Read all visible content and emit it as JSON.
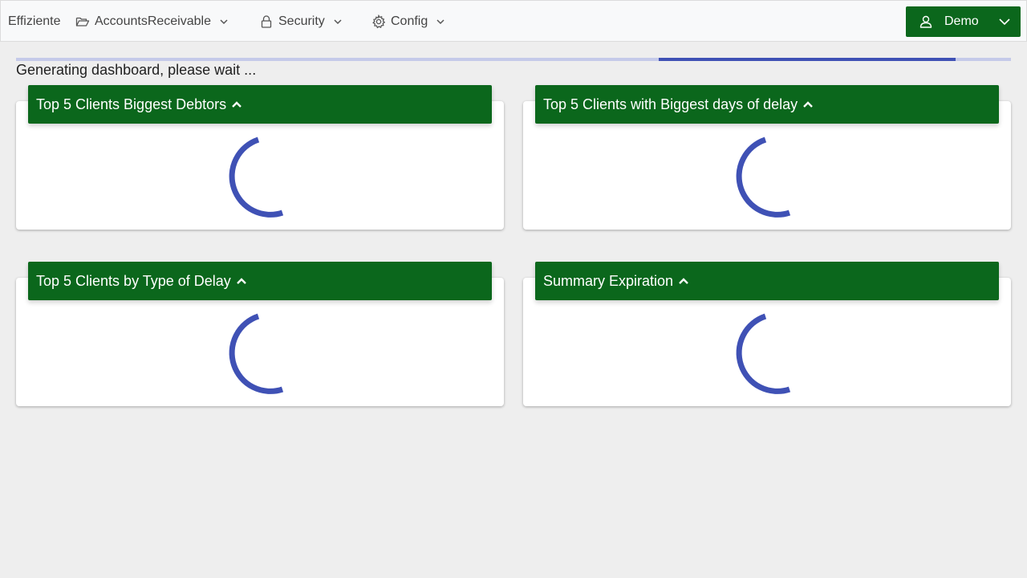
{
  "navbar": {
    "brand": "Effiziente",
    "menus": [
      {
        "label": "AccountsReceivable",
        "icon": "folder-open-icon"
      },
      {
        "label": "Security",
        "icon": "lock-icon"
      },
      {
        "label": "Config",
        "icon": "gear-icon"
      }
    ],
    "user": {
      "label": "Demo",
      "icon": "user-icon"
    }
  },
  "progress": {
    "start_fraction": 0.646,
    "end_fraction": 0.944,
    "indeterminate": true
  },
  "status_text": "Generating dashboard, please wait ...",
  "cards": [
    {
      "title": "Top 5 Clients Biggest Debtors"
    },
    {
      "title": "Top 5 Clients with Biggest days of delay"
    },
    {
      "title": "Top 5 Clients by Type of Delay"
    },
    {
      "title": "Summary Expiration"
    }
  ],
  "colors": {
    "accent_green": "#0b671c",
    "spinner_blue": "#3f51b5",
    "progress_track": "#c5cae9",
    "background": "#eeeeee"
  }
}
